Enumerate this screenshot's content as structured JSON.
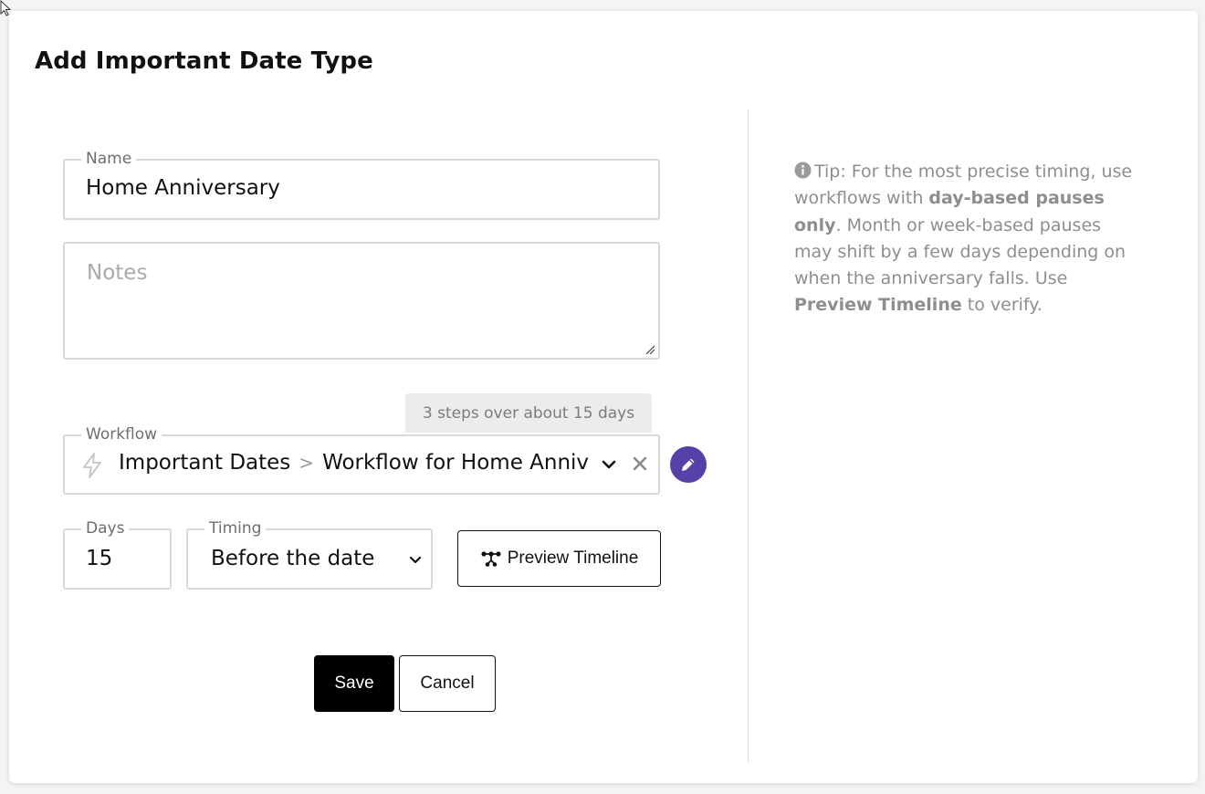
{
  "dialog": {
    "title": "Add Important Date Type"
  },
  "form": {
    "name": {
      "label": "Name",
      "value": "Home Anniversary"
    },
    "notes": {
      "placeholder": "Notes",
      "value": ""
    },
    "steps_badge": "3 steps over about 15 days",
    "workflow": {
      "label": "Workflow",
      "folder": "Important Dates",
      "separator": ">",
      "name": "Workflow for Home Anniversary"
    },
    "days": {
      "label": "Days",
      "value": "15"
    },
    "timing": {
      "label": "Timing",
      "value": "Before the date"
    },
    "preview_label": "Preview Timeline"
  },
  "actions": {
    "save_label": "Save",
    "cancel_label": "Cancel"
  },
  "tip": {
    "prefix": "Tip: For the most precise timing, use workflows with ",
    "bold1": "day-based pauses only",
    "middle": ". Month or week-based pauses may shift by a few days depending on when the anniversary falls. Use ",
    "bold2": "Preview Timeline",
    "suffix": " to verify."
  },
  "colors": {
    "accent": "#5541a8",
    "primary_button": "#000000",
    "field_border": "#d9d9d9",
    "tip_text": "#8e8e8e"
  },
  "icons": {
    "workflow": "bolt-icon",
    "dropdown": "chevron-down-icon",
    "clear": "close-icon",
    "edit": "pencil-icon",
    "preview": "timeline-icon",
    "tip": "info-icon"
  }
}
